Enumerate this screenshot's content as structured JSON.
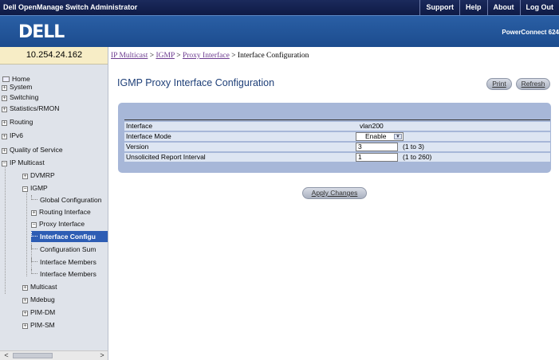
{
  "topbar": {
    "title": "Dell OpenManage Switch Administrator",
    "links": [
      "Support",
      "Help",
      "About",
      "Log Out"
    ]
  },
  "brand": {
    "logo": "DELL",
    "product": "PowerConnect 624"
  },
  "sidebar": {
    "ip": "10.254.24.162",
    "items": [
      {
        "label": "Home",
        "level": 0
      },
      {
        "label": "System",
        "level": 0
      },
      {
        "label": "Switching",
        "level": 0
      },
      {
        "label": "Statistics/RMON",
        "level": 0
      },
      {
        "label": "Routing",
        "level": 0
      },
      {
        "label": "IPv6",
        "level": 0
      },
      {
        "label": "Quality of Service",
        "level": 0
      },
      {
        "label": "IP Multicast",
        "level": 0
      },
      {
        "label": "DVMRP",
        "level": 1
      },
      {
        "label": "IGMP",
        "level": 1
      },
      {
        "label": "Global Configuration",
        "level": 2
      },
      {
        "label": "Routing Interface",
        "level": 2
      },
      {
        "label": "Proxy Interface",
        "level": 2
      },
      {
        "label": "Interface Configu",
        "level": 3,
        "selected": true
      },
      {
        "label": "Configuration Sum",
        "level": 3
      },
      {
        "label": "Interface Members",
        "level": 3
      },
      {
        "label": "Interface Members",
        "level": 3
      },
      {
        "label": "Multicast",
        "level": 1
      },
      {
        "label": "Mdebug",
        "level": 1
      },
      {
        "label": "PIM-DM",
        "level": 1
      },
      {
        "label": "PIM-SM",
        "level": 1
      }
    ],
    "scroll_left": "<",
    "scroll_right": ">"
  },
  "breadcrumb": {
    "links": [
      "IP Multicast",
      "IGMP",
      "Proxy Interface"
    ],
    "separator": " > ",
    "current": "Interface Configuration"
  },
  "page": {
    "title": "IGMP Proxy Interface Configuration",
    "print_label": "Print",
    "refresh_label": "Refresh",
    "apply_label": "Apply Changes"
  },
  "form": {
    "interface_label": "Interface",
    "interface_value": "vlan200",
    "mode_label": "Interface Mode",
    "mode_value": "Enable",
    "version_label": "Version",
    "version_value": "3",
    "version_range": "(1 to 3)",
    "unsolicited_label": "Unsolicited Report Interval",
    "unsolicited_value": "1",
    "unsolicited_range": "(1 to 260)"
  },
  "icons": {
    "expand": "plus-box-icon",
    "home": "home-icon",
    "dropdown": "chevron-down-icon"
  }
}
